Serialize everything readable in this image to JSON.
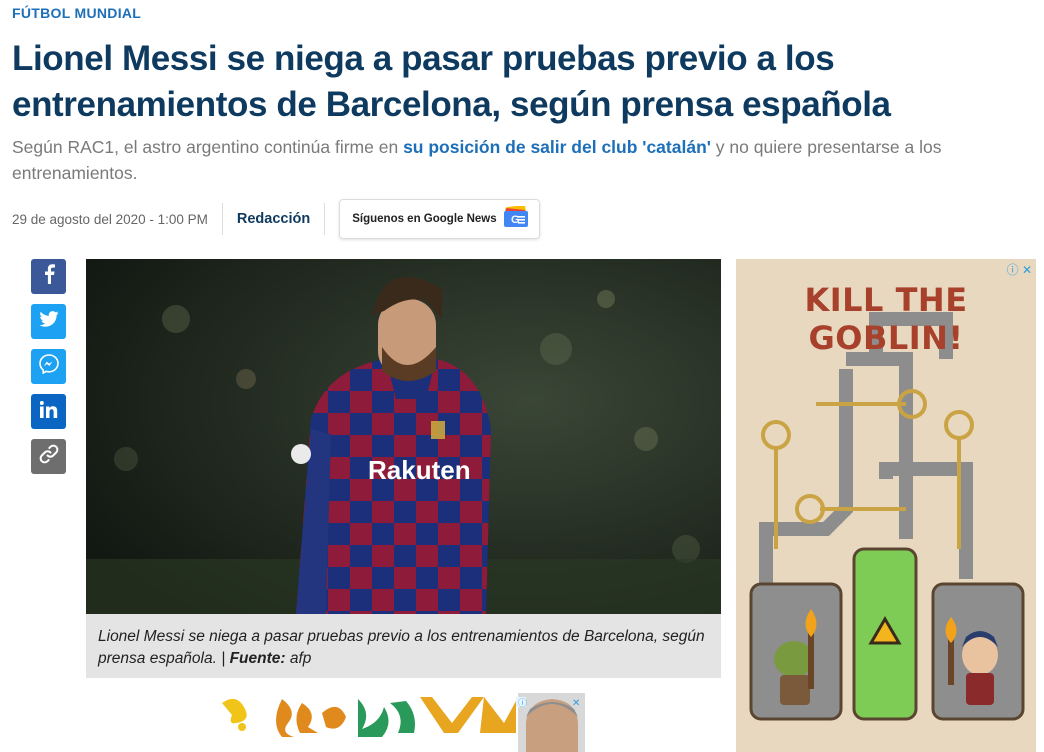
{
  "section": "FÚTBOL MUNDIAL",
  "headline": "Lionel Messi se niega a pasar pruebas previo a los entrenamientos de Barcelona, según prensa española",
  "dek": {
    "before": "Según RAC1, el astro argentino continúa firme en ",
    "link": "su posición de salir del club 'catalán'",
    "after": " y no quiere presentarse a los entrenamientos."
  },
  "meta": {
    "date": "29 de agosto del 2020 - 1:00 PM",
    "author": "Redacción",
    "google_news_label": "Síguenos en Google News",
    "google_news_badge": "G"
  },
  "share": {
    "facebook_icon": "facebook-icon",
    "twitter_icon": "twitter-icon",
    "messenger_icon": "messenger-icon",
    "linkedin_icon": "linkedin-icon",
    "link_icon": "link-icon"
  },
  "photo": {
    "jersey_text": "Rakuten"
  },
  "caption": {
    "text": "Lionel Messi se niega a pasar pruebas previo a los entrenamientos de Barcelona, según prensa española. | ",
    "source_label": "Fuente:",
    "source_value": " afp"
  },
  "ads": {
    "side_title": "KILL THE GOBLIN!",
    "info_symbol": "ⓘ",
    "close_symbol": "✕"
  },
  "colors": {
    "headline": "#0e3a5f",
    "accent": "#1d6fb8",
    "facebook": "#3b5998",
    "twitter": "#1da1f2",
    "linkedin": "#0a66c2"
  }
}
